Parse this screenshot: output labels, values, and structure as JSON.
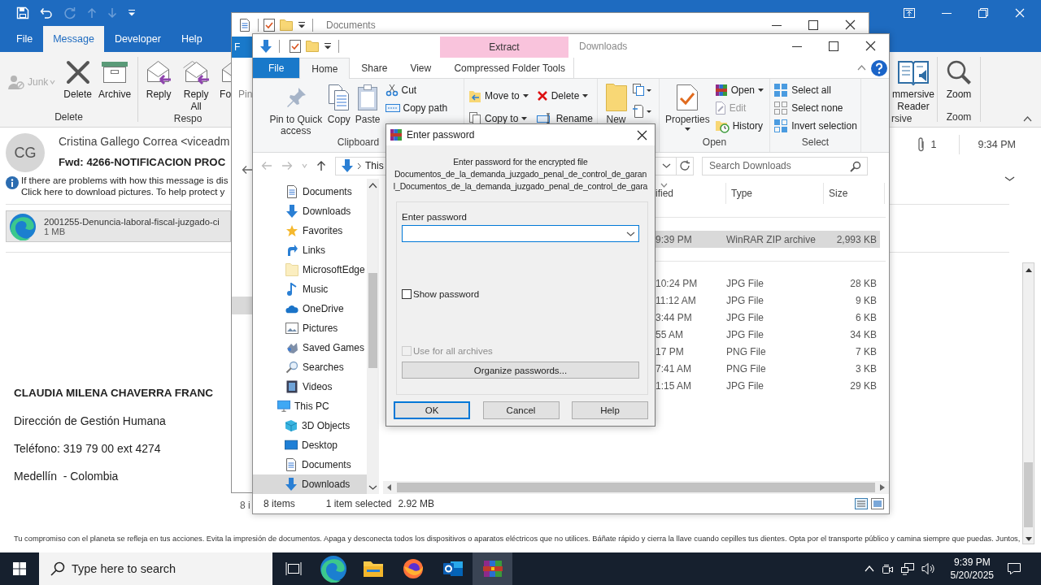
{
  "outlook": {
    "tabs": [
      {
        "label": "File",
        "selected": false
      },
      {
        "label": "Message",
        "selected": true
      },
      {
        "label": "Developer",
        "selected": false
      },
      {
        "label": "Help",
        "selected": false
      }
    ],
    "ribbon": {
      "junk": {
        "label": "Junk",
        "disabled": true
      },
      "groups": [
        {
          "label": "Delete",
          "buttons": [
            "Delete",
            "Archive"
          ]
        },
        {
          "label": "Respo",
          "buttons": [
            "Reply",
            "Reply All",
            "Fo"
          ]
        }
      ],
      "right_groups": [
        {
          "label": "rsive",
          "buttons": [
            "mmersive Reader"
          ]
        },
        {
          "label": "Zoom",
          "buttons": [
            "Zoom"
          ]
        }
      ]
    },
    "message": {
      "avatar": "CG",
      "sender": "Cristina Gallego Correa <viceadm",
      "subject": "Fwd: 4266-NOTIFICACION PROC",
      "notice": [
        "If there are problems with how this message is dis",
        "Click here to download pictures. To help protect y"
      ],
      "attachment": {
        "name": "2001255-Denuncia-laboral-fiscal-juzgado-ci",
        "size": "1 MB"
      },
      "attachment_count": "1",
      "time": "9:34 PM",
      "body": [
        {
          "kind": "name",
          "text": "CLAUDIA MILENA CHAVERRA FRANC"
        },
        {
          "kind": "line",
          "text": "Dirección de Gestión Humana"
        },
        {
          "kind": "line",
          "text": "Teléfono: 319 79 00 ext 4274"
        },
        {
          "kind": "line",
          "text": "Medellín  - Colombia"
        }
      ],
      "footer": "Tu compromiso con el planeta se refleja en tus acciones. Evita la impresión de documentos. Apaga y desconecta todos los dispositivos o aparatos eléctricos que no utilices. Báñate rápido y cierra la llave cuando cepilles tus dientes. Opta por el transporte público y camina siempre que puedas. Juntos,"
    }
  },
  "back_window": {
    "title": "Documents",
    "tab": "F",
    "ribbon_text": "Pin",
    "status": "8 i"
  },
  "explorer": {
    "title": "Downloads",
    "context_group": "Extract",
    "tabs": [
      {
        "label": "File",
        "kind": "file",
        "selected": false
      },
      {
        "label": "Home",
        "kind": "tab",
        "selected": true
      },
      {
        "label": "Share",
        "kind": "tab",
        "selected": false
      },
      {
        "label": "View",
        "kind": "tab",
        "selected": false
      },
      {
        "label": "Compressed Folder Tools",
        "kind": "context",
        "selected": false
      }
    ],
    "ribbon": {
      "clipboard": {
        "label": "Clipboard",
        "large": [
          "Pin to Quick access",
          "Copy",
          "Paste"
        ],
        "small": [
          "Cut",
          "Copy path"
        ]
      },
      "organize": [
        {
          "label": "Move to",
          "dropdown": true
        },
        {
          "label": "Copy to",
          "dropdown": true
        },
        {
          "label": "Delete",
          "dropdown": true
        },
        {
          "label": "Rename",
          "dropdown": false
        }
      ],
      "new": "New",
      "open": {
        "label": "Open",
        "large": "Properties",
        "small": [
          {
            "label": "Open",
            "disabled": false,
            "dropdown": true
          },
          {
            "label": "Edit",
            "disabled": true,
            "dropdown": false
          },
          {
            "label": "History",
            "disabled": false,
            "dropdown": false
          }
        ]
      },
      "select": {
        "label": "Select",
        "small": [
          "Select all",
          "Select none",
          "Invert selection"
        ]
      }
    },
    "address": {
      "crumb": "This",
      "search_placeholder": "Search Downloads"
    },
    "nav": {
      "items": [
        {
          "label": "Documents",
          "selected": false
        },
        {
          "label": "Downloads",
          "selected": false
        },
        {
          "label": "Favorites",
          "selected": false
        },
        {
          "label": "Links",
          "selected": false
        },
        {
          "label": "MicrosoftEdge",
          "selected": false
        },
        {
          "label": "Music",
          "selected": false
        },
        {
          "label": "OneDrive",
          "selected": false
        },
        {
          "label": "Pictures",
          "selected": false
        },
        {
          "label": "Saved Games",
          "selected": false
        },
        {
          "label": "Searches",
          "selected": false
        },
        {
          "label": "Videos",
          "selected": false
        }
      ],
      "this_pc": {
        "label": "This PC",
        "selected": false,
        "children": [
          {
            "label": "3D Objects",
            "selected": false
          },
          {
            "label": "Desktop",
            "selected": false
          },
          {
            "label": "Documents",
            "selected": false
          },
          {
            "label": "Downloads",
            "selected": true
          }
        ]
      }
    },
    "columns": [
      "ified",
      "Type",
      "Size"
    ],
    "groups": [
      [
        {
          "modified": "9:39 PM",
          "type": "WinRAR ZIP archive",
          "size": "2,993 KB",
          "selected": true
        }
      ],
      [
        {
          "modified": "10:24 PM",
          "type": "JPG File",
          "size": "28 KB",
          "selected": false
        },
        {
          "modified": "11:12 AM",
          "type": "JPG File",
          "size": "9 KB",
          "selected": false
        },
        {
          "modified": "3:44 PM",
          "type": "JPG File",
          "size": "6 KB",
          "selected": false
        },
        {
          "modified": "55 AM",
          "type": "JPG File",
          "size": "34 KB",
          "selected": false
        },
        {
          "modified": "17 PM",
          "type": "PNG File",
          "size": "7 KB",
          "selected": false
        },
        {
          "modified": "7:41 AM",
          "type": "PNG File",
          "size": "3 KB",
          "selected": false
        },
        {
          "modified": "1:15 AM",
          "type": "JPG File",
          "size": "29 KB",
          "selected": false
        }
      ]
    ],
    "status": {
      "count": "8 items",
      "selection": "1 item selected",
      "size": "2.92 MB"
    }
  },
  "dialog": {
    "title": "Enter password",
    "message": [
      "Enter password for the encrypted file",
      "Documentos_de_la_demanda_juzgado_penal_de_control_de_garan",
      "l_Documentos_de_la_demanda_juzgado_penal_de_control_de_gara"
    ],
    "field_label": "Enter password",
    "show_password": {
      "label": "Show password",
      "checked": false
    },
    "use_for_all": {
      "label": "Use for all archives",
      "checked": false,
      "disabled": true
    },
    "organize": "Organize passwords...",
    "buttons": [
      {
        "label": "OK",
        "default": true
      },
      {
        "label": "Cancel",
        "default": false
      },
      {
        "label": "Help",
        "default": false
      }
    ]
  },
  "taskbar": {
    "search_placeholder": "Type here to search",
    "apps": [
      {
        "selected": false
      },
      {
        "selected": false
      },
      {
        "selected": false
      },
      {
        "selected": false
      },
      {
        "selected": true
      }
    ],
    "time": "9:39 PM",
    "date": "5/20/2025"
  }
}
